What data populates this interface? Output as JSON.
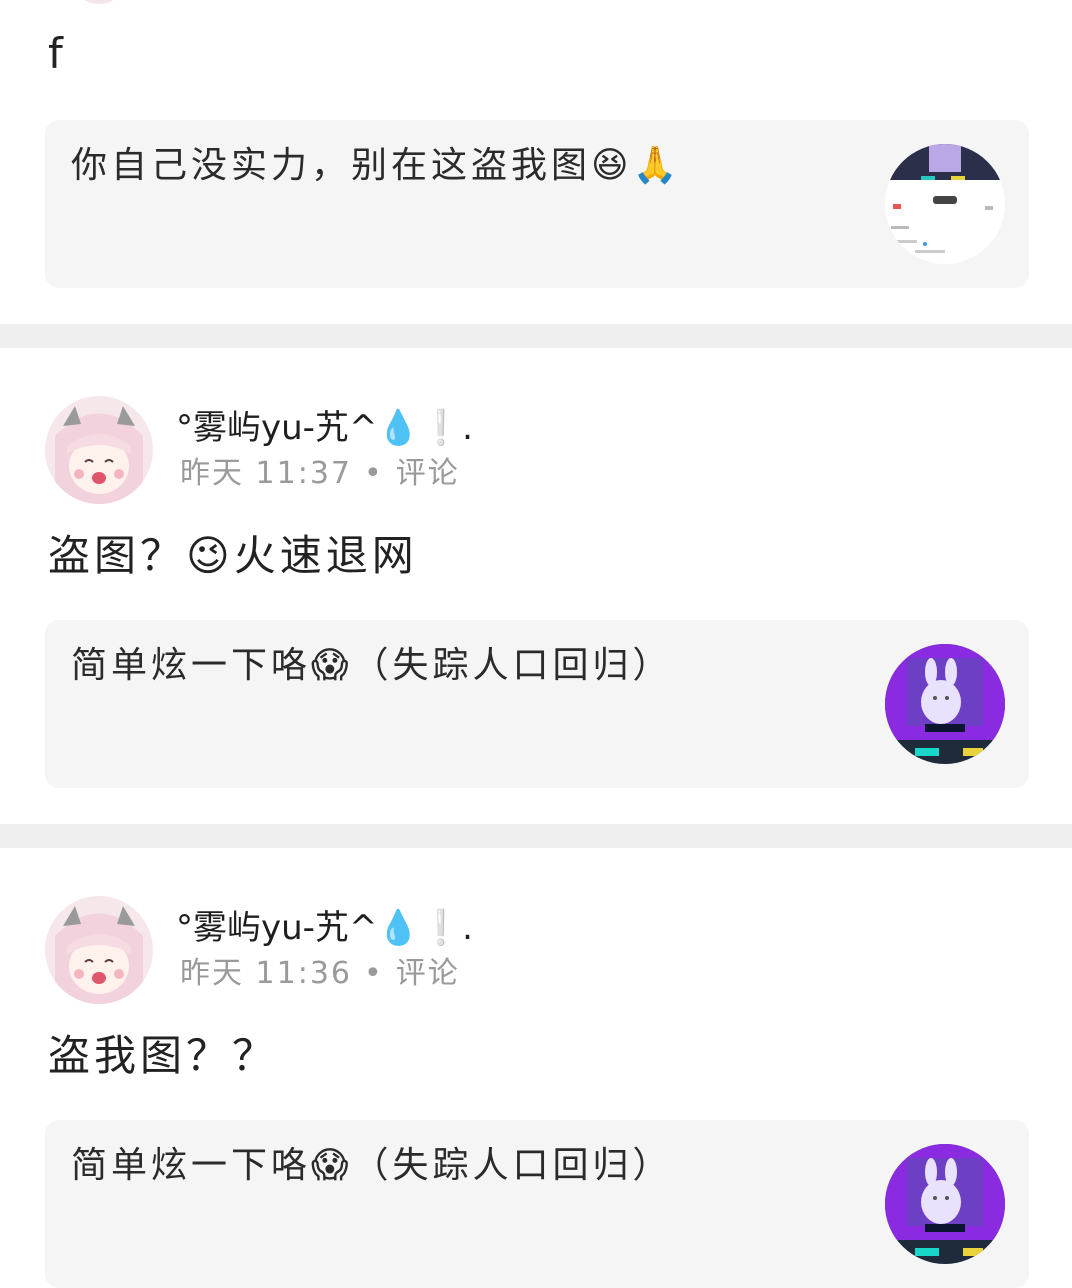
{
  "top_comment": {
    "text": "f",
    "quote": {
      "text": "你自己没实力，别在这盗我图😆🙏"
    }
  },
  "comments": [
    {
      "username": "°雾屿yu-艽^💧❕.",
      "time": "昨天 11:37",
      "dot": "•",
      "action": "评论",
      "text": "盗图？😉火速退网",
      "quote": {
        "text": "简单炫一下咯😱（失踪人口回归）"
      }
    },
    {
      "username": "°雾屿yu-艽^💧❕.",
      "time": "昨天 11:36",
      "dot": "•",
      "action": "评论",
      "text": "盗我图？？",
      "quote": {
        "text": "简单炫一下咯😱（失踪人口回归）"
      }
    }
  ],
  "icons": {
    "avatar": "avatar-anime-girl",
    "thumb_top": "screenshot-thumbnail",
    "thumb_other": "rabbit-game-thumbnail"
  }
}
